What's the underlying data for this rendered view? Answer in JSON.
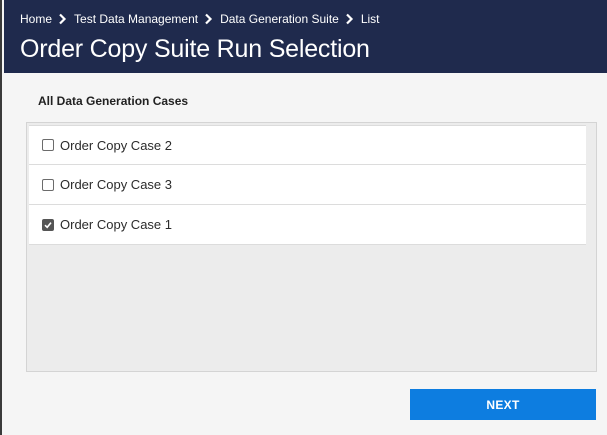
{
  "header": {
    "breadcrumb": [
      {
        "label": "Home"
      },
      {
        "label": "Test Data Management"
      },
      {
        "label": "Data Generation Suite"
      },
      {
        "label": "List"
      }
    ],
    "title": "Order Copy Suite Run Selection"
  },
  "main": {
    "section_title": "All Data Generation Cases",
    "cases": [
      {
        "label": "Order Copy Case 2",
        "checked": false
      },
      {
        "label": "Order Copy Case 3",
        "checked": false
      },
      {
        "label": "Order Copy Case 1",
        "checked": true
      }
    ]
  },
  "footer": {
    "next_label": "NEXT"
  },
  "colors": {
    "header_bg": "#1f2a4d",
    "button_bg": "#0d7de0",
    "panel_bg": "#ececec"
  },
  "icons": {
    "breadcrumb_separator": "chevron-right-icon",
    "checked": "checkbox-checked-icon",
    "unchecked": "checkbox-unchecked-icon"
  }
}
